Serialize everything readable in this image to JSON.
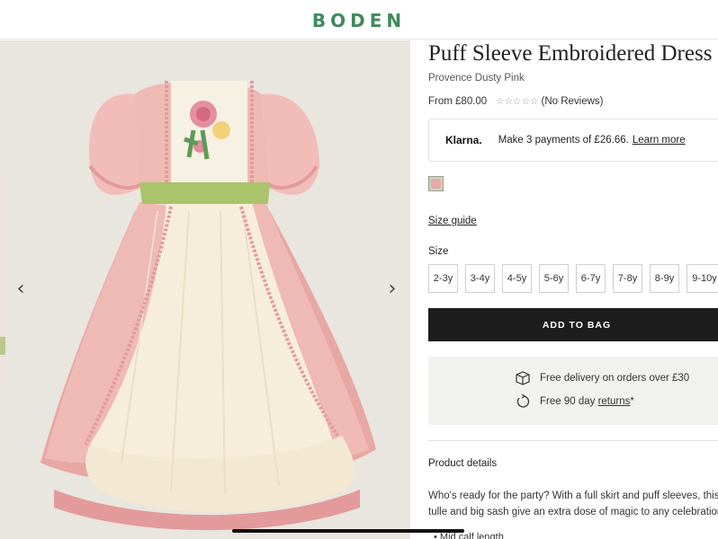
{
  "header": {
    "logo": "BODEN"
  },
  "gallery": {
    "prev_icon": "chevron-left-icon",
    "next_icon": "chevron-right-icon",
    "prev_glyph": "‹",
    "next_glyph": "›"
  },
  "product": {
    "title": "Puff Sleeve Embroidered Dress",
    "color": "Provence Dusty Pink",
    "price": "From £80.00",
    "stars": "☆☆☆☆☆",
    "reviews": "(No Reviews)"
  },
  "klarna": {
    "logo": "Klarna.",
    "text": "Make 3 payments of £26.66.",
    "link": "Learn more"
  },
  "size_guide": "Size guide",
  "size_label": "Size",
  "sizes": [
    "2-3y",
    "3-4y",
    "4-5y",
    "5-6y",
    "6-7y",
    "7-8y",
    "8-9y",
    "9-10y"
  ],
  "add_to_bag": "ADD TO BAG",
  "delivery": {
    "line1": "Free delivery on orders over £30",
    "line2_prefix": "Free 90 day",
    "line2_link": "returns",
    "line2_suffix": "*"
  },
  "product_details": {
    "heading": "Product details",
    "desc_line1": "Who's ready for the party? With a full skirt and puff sleeves, this d",
    "desc_line2": "tulle and big sash give an extra dose of magic to any celebration.",
    "bullet1": "• Mid calf length"
  },
  "colors": {
    "brand": "#3f8a5e",
    "button": "#1d1d1d",
    "gallery_bg": "#e9e5df",
    "dress_pink": "#eeb2ad",
    "sash_green": "#a9c46a"
  }
}
